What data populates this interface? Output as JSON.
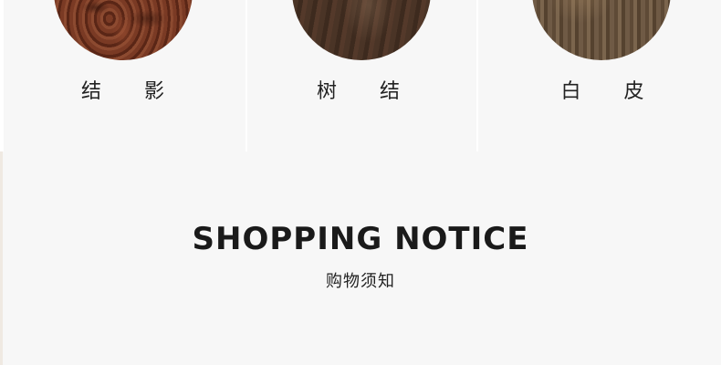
{
  "swatches": [
    {
      "label": "结 影",
      "icon": "burl-wood-swatch"
    },
    {
      "label": "树 结",
      "icon": "knot-wood-swatch"
    },
    {
      "label": "白 皮",
      "icon": "sapwood-swatch"
    }
  ],
  "notice": {
    "title": "SHOPPING NOTICE",
    "subtitle": "购物须知"
  },
  "colors": {
    "background": "#f7f7f7",
    "text": "#1a1a1a"
  }
}
